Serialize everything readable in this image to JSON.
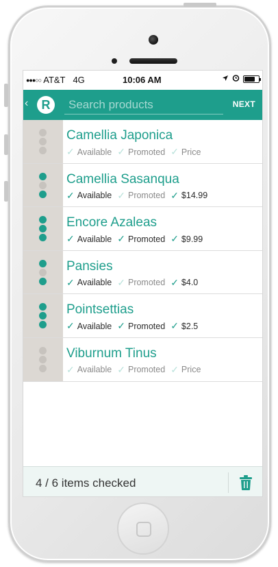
{
  "status_bar": {
    "signal_dots": "●●●○○",
    "carrier": "AT&T",
    "network": "4G",
    "time": "10:06 AM",
    "location_icon": "location-arrow-icon",
    "alarm_icon": "alarm-clock-icon",
    "battery_level": 0.75
  },
  "navbar": {
    "back_icon": "chevron-left-icon",
    "logo_letter": "R",
    "search_placeholder": "Search products",
    "search_value": "",
    "next_label": "NEXT"
  },
  "products": [
    {
      "name": "Camellia Japonica",
      "available": false,
      "promoted": false,
      "price_checked": false,
      "price_text": "Price",
      "available_label": "Available",
      "promoted_label": "Promoted"
    },
    {
      "name": "Camellia Sasanqua",
      "available": true,
      "promoted": false,
      "price_checked": true,
      "price_text": "$14.99",
      "available_label": "Available",
      "promoted_label": "Promoted"
    },
    {
      "name": "Encore Azaleas",
      "available": true,
      "promoted": true,
      "price_checked": true,
      "price_text": "$9.99",
      "available_label": "Available",
      "promoted_label": "Promoted"
    },
    {
      "name": "Pansies",
      "available": true,
      "promoted": false,
      "price_checked": true,
      "price_text": "$4.0",
      "available_label": "Available",
      "promoted_label": "Promoted"
    },
    {
      "name": "Pointsettias",
      "available": true,
      "promoted": true,
      "price_checked": true,
      "price_text": "$2.5",
      "available_label": "Available",
      "promoted_label": "Promoted"
    },
    {
      "name": "Viburnum Tinus",
      "available": false,
      "promoted": false,
      "price_checked": false,
      "price_text": "Price",
      "available_label": "Available",
      "promoted_label": "Promoted"
    }
  ],
  "footer": {
    "summary": "4 / 6 items checked",
    "trash_icon": "trash-icon"
  },
  "colors": {
    "accent": "#1e9e8c",
    "handle_bg": "#dcd8d3",
    "dot_off": "#c7c3be"
  }
}
